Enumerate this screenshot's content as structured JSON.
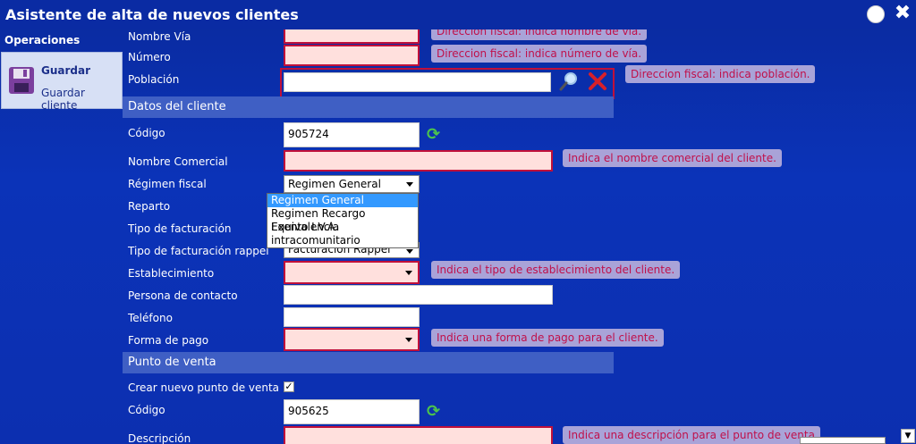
{
  "window": {
    "title": "Asistente de alta de nuevos clientes"
  },
  "sidebar": {
    "section_title": "Operaciones",
    "action": {
      "title": "Guardar",
      "subtitle": "Guardar cliente",
      "icon": "floppy-disk-icon"
    }
  },
  "address": {
    "street_label": "Nombre Vía",
    "street_hint": "Direccion fiscal: indica nombre de vía.",
    "number_label": "Número",
    "number_hint": "Direccion fiscal: indica número de vía.",
    "town_label": "Población",
    "town_hint": "Direccion fiscal: indica población."
  },
  "client": {
    "section_title": "Datos del cliente",
    "code_label": "Código",
    "code_value": "905724",
    "trade_name_label": "Nombre Comercial",
    "trade_name_hint": "Indica el nombre comercial del cliente.",
    "tax_regime_label": "Régimen fiscal",
    "tax_regime_value": "Regimen General",
    "tax_regime_options": [
      "Regimen General",
      "Regimen Recargo Equivalencia",
      "Exento I.V.A.",
      "intracomunitario"
    ],
    "distribution_label": "Reparto",
    "billing_type_label": "Tipo de facturación",
    "rebate_billing_label": "Tipo de facturación rappel",
    "rebate_billing_value": "Facturación Rappel",
    "establishment_label": "Establecimiento",
    "establishment_hint": "Indica el tipo de establecimiento del cliente.",
    "contact_label": "Persona de contacto",
    "phone_label": "Teléfono",
    "payment_label": "Forma de pago",
    "payment_hint": "Indica una forma de pago para el cliente."
  },
  "point_of_sale": {
    "section_title": "Punto de venta",
    "create_label": "Crear nuevo punto de venta",
    "create_checked": true,
    "code_label": "Código",
    "code_value": "905625",
    "description_label": "Descripción",
    "description_hint": "Indica una descripción para el punto de venta"
  },
  "colors": {
    "background": "#0b33b8",
    "required_bg": "#ffe0dd",
    "required_border": "#c0103a",
    "hint_bg": "#a9a3d8",
    "hint_text": "#c0104a"
  }
}
